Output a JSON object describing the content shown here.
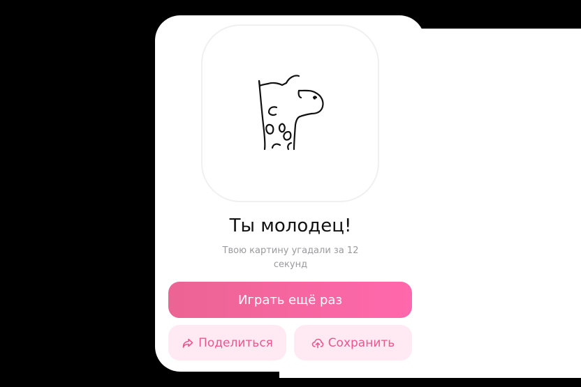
{
  "result": {
    "title": "Ты молодец!",
    "subtitle": "Твою картину угадали за 12 секунд"
  },
  "drawing": {
    "subject": "giraffe-sketch",
    "stroke_color": "#111111"
  },
  "actions": {
    "play_again_label": "Играть ещё раз",
    "share_label": "Поделиться",
    "share_icon": "share-arrow-icon",
    "save_label": "Сохранить",
    "save_icon": "cloud-upload-icon"
  },
  "colors": {
    "primary_gradient_start": "#ec6493",
    "primary_gradient_end": "#ff68ac",
    "secondary_bg": "#ffeaf3",
    "secondary_text": "#e9578e"
  }
}
